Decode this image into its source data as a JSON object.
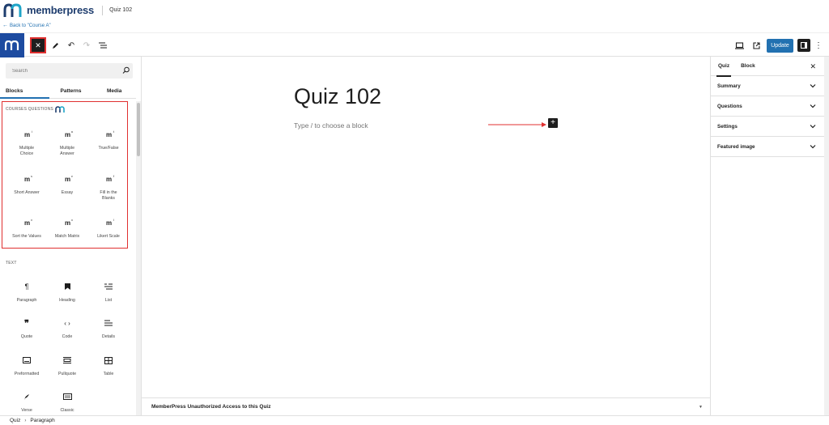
{
  "app": {
    "brand": "memberpress",
    "document_title": "Quiz 102",
    "back_link": "Back to \"Course A\""
  },
  "toolbar": {
    "update_label": "Update",
    "accent_color": "#2271b1"
  },
  "inserter": {
    "search_placeholder": "Search",
    "tabs": [
      "Blocks",
      "Patterns",
      "Media"
    ],
    "active_tab": "Blocks",
    "course_questions": {
      "title": "COURSES QUESTIONS",
      "items": [
        {
          "label1": "Multiple",
          "label2": "Choice"
        },
        {
          "label1": "Multiple",
          "label2": "Answer"
        },
        {
          "label1": "True/False",
          "label2": ""
        },
        {
          "label1": "Short Answer",
          "label2": ""
        },
        {
          "label1": "Essay",
          "label2": ""
        },
        {
          "label1": "Fill in the",
          "label2": "Blanks"
        },
        {
          "label1": "Sort the Values",
          "label2": ""
        },
        {
          "label1": "Match Matrix",
          "label2": ""
        },
        {
          "label1": "Likert Scale",
          "label2": ""
        }
      ]
    },
    "text": {
      "title": "TEXT",
      "items": [
        {
          "label": "Paragraph",
          "icon": "paragraph-icon"
        },
        {
          "label": "Heading",
          "icon": "heading-icon"
        },
        {
          "label": "List",
          "icon": "list-icon"
        },
        {
          "label": "Quote",
          "icon": "quote-icon"
        },
        {
          "label": "Code",
          "icon": "code-icon"
        },
        {
          "label": "Details",
          "icon": "details-icon"
        },
        {
          "label": "Preformatted",
          "icon": "preformatted-icon"
        },
        {
          "label": "Pullquote",
          "icon": "pullquote-icon"
        },
        {
          "label": "Table",
          "icon": "table-icon"
        },
        {
          "label": "Verse",
          "icon": "verse-icon"
        },
        {
          "label": "Classic",
          "icon": "classic-icon"
        }
      ]
    }
  },
  "canvas": {
    "title": "Quiz 102",
    "placeholder": "Type / to choose a block",
    "meta_box_title": "MemberPress Unauthorized Access to this Quiz"
  },
  "settings": {
    "tabs": [
      "Quiz",
      "Block"
    ],
    "active_tab": "Quiz",
    "panels": [
      "Summary",
      "Questions",
      "Settings",
      "Featured image"
    ]
  },
  "breadcrumb": [
    "Quiz",
    "Paragraph"
  ]
}
